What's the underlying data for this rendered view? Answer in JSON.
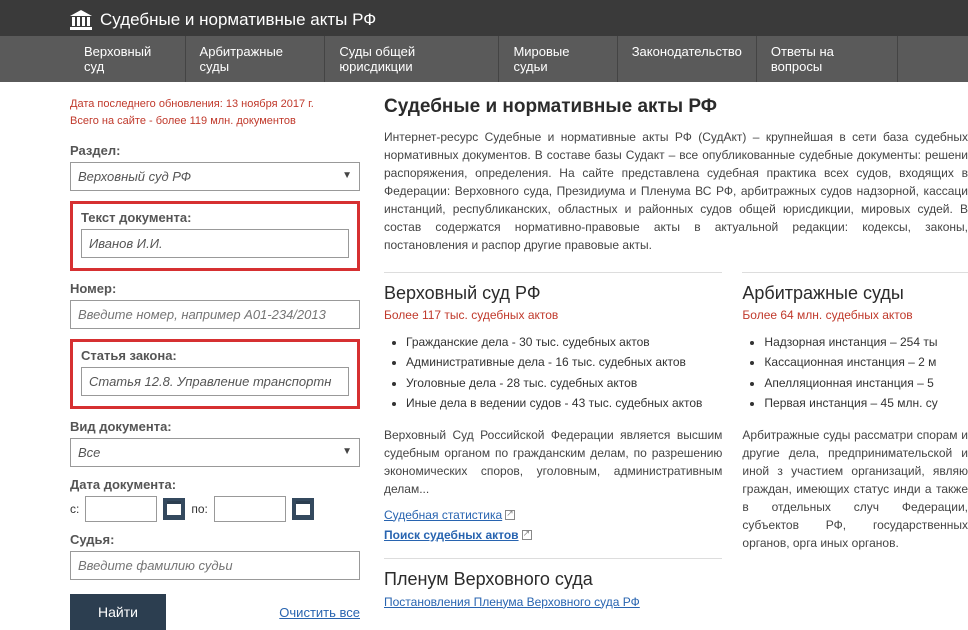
{
  "header": {
    "title": "Судебные и нормативные акты РФ"
  },
  "nav": [
    "Верховный суд",
    "Арбитражные суды",
    "Суды общей юрисдикции",
    "Мировые судьи",
    "Законодательство",
    "Ответы на вопросы"
  ],
  "sidebar": {
    "update_line1": "Дата последнего обновления: 13 ноября 2017 г.",
    "update_line2": "Всего на сайте - более 119 млн. документов",
    "section_label": "Раздел:",
    "section_value": "Верховный суд РФ",
    "doctext_label": "Текст документа:",
    "doctext_value": "Иванов И.И.",
    "number_label": "Номер:",
    "number_placeholder": "Введите номер, например А01-234/2013",
    "article_label": "Статья закона:",
    "article_value": "Статья 12.8. Управление транспортн",
    "doctype_label": "Вид документа:",
    "doctype_value": "Все",
    "docdate_label": "Дата документа:",
    "date_from": "с:",
    "date_to": "по:",
    "judge_label": "Судья:",
    "judge_placeholder": "Введите фамилию судьи",
    "find_button": "Найти",
    "clear_link": "Очистить все"
  },
  "main": {
    "title": "Судебные и нормативные акты РФ",
    "description": "Интернет-ресурс Судебные и нормативные акты РФ (СудАкт) – крупнейшая в сети база судебных нормативных документов. В составе базы Судакт – все опубликованные судебные документы: решени распоряжения, определения. На сайте представлена судебная практика всех судов, входящих в Федерации: Верховного суда, Президиума и Пленума ВС РФ, арбитражных судов надзорной, кассаци инстанций, республиканских, областных и районных судов общей юрисдикции, мировых судей. В состав содержатся нормативно-правовые акты в актуальной редакции: кодексы, законы, постановления и распор другие правовые акты."
  },
  "sections": [
    {
      "title": "Верховный суд РФ",
      "subtitle": "Более 117 тыс. судебных актов",
      "items": [
        "Гражданские дела - 30 тыс. судебных актов",
        "Административные дела - 16 тыс. судебных актов",
        "Уголовные дела - 28 тыс. судебных актов",
        "Иные дела в ведении судов - 43 тыс. судебных актов"
      ],
      "desc": "Верховный Суд Российской Федерации является высшим судебным органом по гражданским делам, по разрешению экономических споров, уголовным, административным делам...",
      "link1": "Судебная статистика",
      "link2": "Поиск судебных актов",
      "sub_title": "Пленум Верховного суда",
      "sub_link": "Постановления Пленума Верховного суда РФ"
    },
    {
      "title": "Арбитражные суды",
      "subtitle": "Более 64 млн. судебных актов",
      "items": [
        "Надзорная инстанция – 254 ты",
        "Кассационная инстанция – 2 м",
        "Апелляционная инстанция – 5",
        "Первая инстанция – 45 млн. су"
      ],
      "desc": "Арбитражные суды рассматри спорам и другие дела, предпринимательской и иной з участием организаций, являю граждан, имеющих статус инди а также в отдельных случ Федерации, субъектов РФ, государственных органов, орга иных органов."
    }
  ]
}
